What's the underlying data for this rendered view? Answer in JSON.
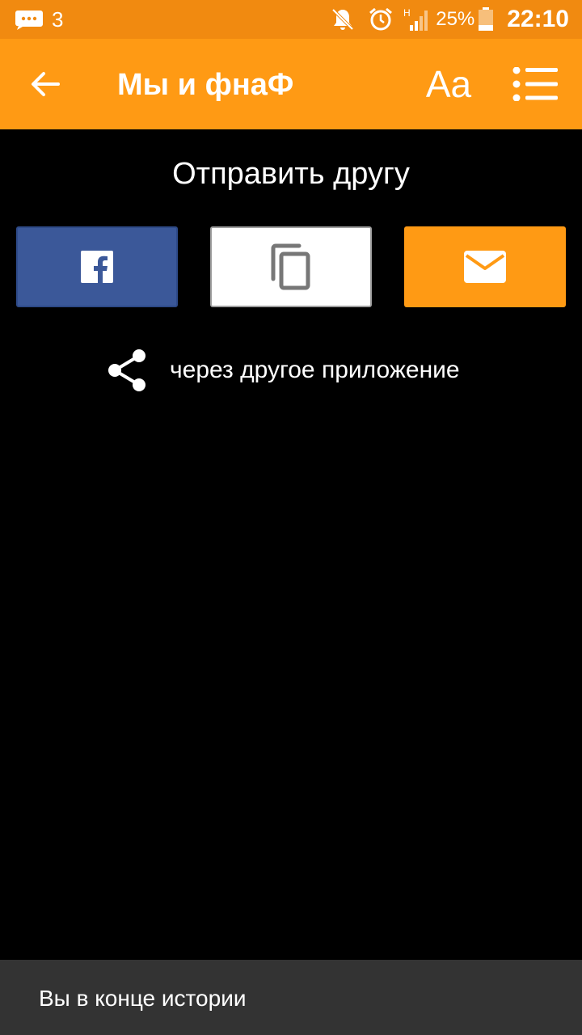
{
  "status_bar": {
    "notification_count": "3",
    "battery_percent": "25%",
    "time": "22:10",
    "icons": [
      "message-icon",
      "bell-off-icon",
      "alarm-icon",
      "signal-icon",
      "battery-icon"
    ],
    "network_label": "H"
  },
  "app_bar": {
    "title": "Мы и фнаФ",
    "font_button_label": "Aa",
    "icons": [
      "back-arrow-icon",
      "list-menu-icon"
    ],
    "color": "#FF9A14"
  },
  "share": {
    "title": "Отправить другу",
    "buttons": [
      {
        "name": "facebook",
        "icon": "facebook-icon",
        "color": "#3B5899"
      },
      {
        "name": "copy",
        "icon": "copy-icon",
        "color": "#FFFFFF"
      },
      {
        "name": "email",
        "icon": "email-icon",
        "color": "#FF9A14"
      }
    ],
    "other_app_label": "через другое приложение",
    "other_app_icon": "share-icon"
  },
  "snackbar": {
    "message": "Вы в конце истории"
  }
}
